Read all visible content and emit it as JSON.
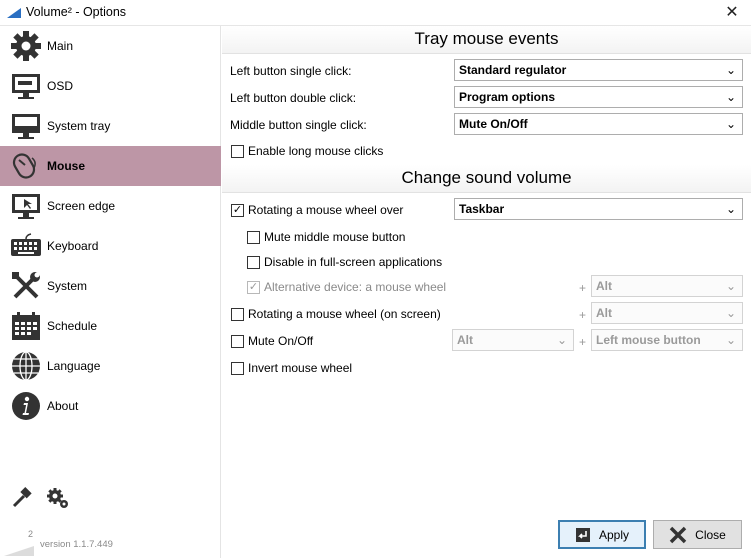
{
  "window": {
    "title": "Volume² - Options",
    "close_glyph": "✕"
  },
  "sidebar": {
    "items": [
      {
        "label": "Main",
        "icon": "gear-icon"
      },
      {
        "label": "OSD",
        "icon": "monitor-icon"
      },
      {
        "label": "System tray",
        "icon": "tray-icon"
      },
      {
        "label": "Mouse",
        "icon": "mouse-icon",
        "active": true
      },
      {
        "label": "Screen edge",
        "icon": "screen-edge-icon"
      },
      {
        "label": "Keyboard",
        "icon": "keyboard-icon"
      },
      {
        "label": "System",
        "icon": "tools-icon"
      },
      {
        "label": "Schedule",
        "icon": "calendar-icon"
      },
      {
        "label": "Language",
        "icon": "globe-icon"
      },
      {
        "label": "About",
        "icon": "info-icon"
      }
    ],
    "active_color": "#bd96a6",
    "version_sup": "2",
    "version": "version 1.1.7.449"
  },
  "tray": {
    "title": "Tray mouse events",
    "left_single_label": "Left button single click:",
    "left_single_value": "Standard regulator",
    "left_double_label": "Left button double click:",
    "left_double_value": "Program options",
    "middle_single_label": "Middle button single click:",
    "middle_single_value": "Mute On/Off",
    "long_clicks_label": "Enable long mouse clicks",
    "long_clicks_checked": false
  },
  "volume": {
    "title": "Change sound volume",
    "rotating_label": "Rotating a mouse wheel over",
    "rotating_checked": true,
    "rotating_value": "Taskbar",
    "mute_middle_label": "Mute middle mouse button",
    "disable_fullscreen_label": "Disable in full-screen applications",
    "alt_device_label": "Alternative device: a mouse wheel",
    "alt_device_checked": true,
    "alt_device_mod": "Alt",
    "rotating_screen_label": "Rotating a mouse wheel (on screen)",
    "rotating_screen_mod": "Alt",
    "mute_onoff_label": "Mute On/Off",
    "mute_onoff_mod": "Alt",
    "mute_onoff_button": "Left mouse button",
    "invert_label": "Invert mouse wheel",
    "plus": "+",
    "check_glyph": "✓",
    "chevron": "⌄"
  },
  "footer": {
    "apply": "Apply",
    "close": "Close"
  }
}
